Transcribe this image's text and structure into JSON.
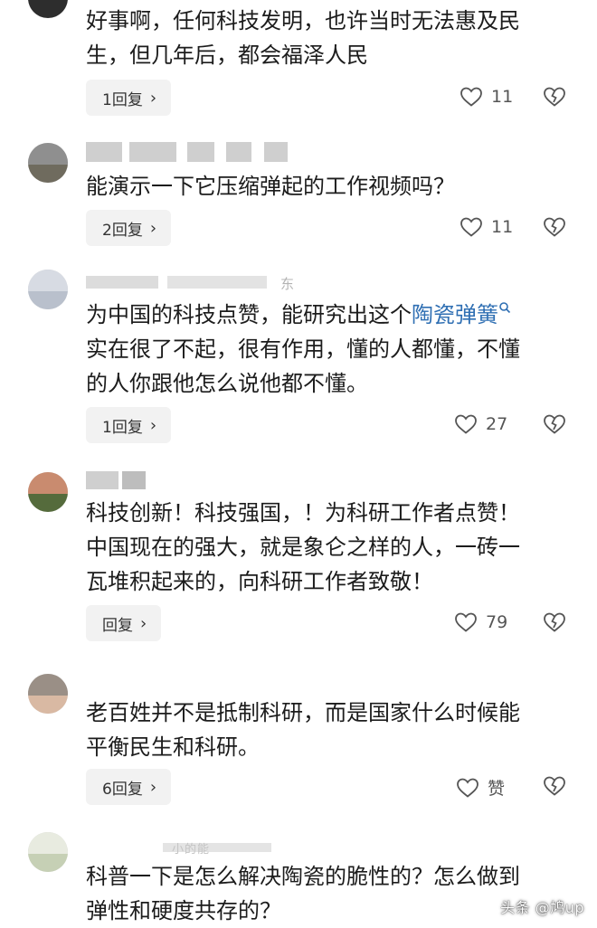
{
  "comments": [
    {
      "text": "好事啊，任何科技发明，也许当时无法惠及民\n生，但几年后，都会福泽人民",
      "reply_label": "1回复",
      "like_count": "11"
    },
    {
      "text": "能演示一下它压缩弹起的工作视频吗？",
      "reply_label": "2回复",
      "like_count": "11"
    },
    {
      "name_partial": "东",
      "text_before": "为中国的科技点赞，能研究出这个",
      "link_text": "陶瓷弹簧",
      "text_after": "\n实在很了不起，很有作用，懂的人都懂，不懂\n的人你跟他怎么说他都不懂。",
      "reply_label": "1回复",
      "like_count": "27"
    },
    {
      "text": "科技创新！科技强国，！为科研工作者点赞！\n中国现在的强大，就是象仑之样的人，一砖一\n瓦堆积起来的，向科研工作者致敬！",
      "reply_label": "回复",
      "like_count": "79"
    },
    {
      "text": "老百姓并不是抵制科研，而是国家什么时候能\n平衡民生和科研。",
      "reply_label": "6回复",
      "like_count": "赞"
    },
    {
      "name_partial": "小的能",
      "text": "科普一下是怎么解决陶瓷的脆性的？怎么做到\n弹性和硬度共存的？"
    }
  ],
  "icons": {
    "like": "heart-outline-icon",
    "dislike": "broken-heart-icon",
    "reply_more": "chevron-right-icon",
    "search": "search-icon"
  },
  "colors": {
    "link": "#2f6fb3",
    "reply_bg": "#f2f2f2"
  },
  "watermark": "头条 @鸠up"
}
